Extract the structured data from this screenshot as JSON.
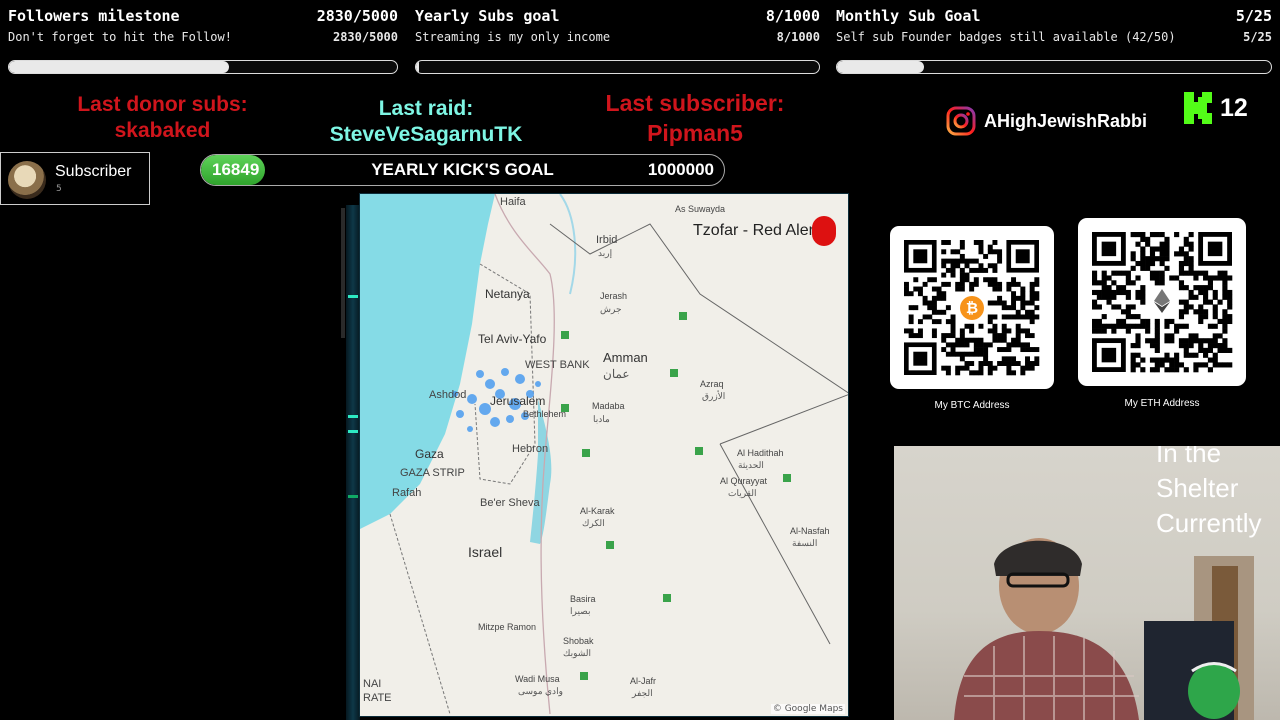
{
  "goals": [
    {
      "title": "Followers milestone",
      "count": "2830/5000",
      "subtitle": "Don't forget to hit the Follow!",
      "count_small": "2830/5000",
      "progress": 0.566
    },
    {
      "title": "Yearly Subs goal",
      "count": "8/1000",
      "subtitle": "Streaming is my only income",
      "count_small": "8/1000",
      "progress": 0.008
    },
    {
      "title": "Monthly Sub Goal",
      "count": "5/25",
      "subtitle": "Self sub Founder badges still available (42/50)",
      "count_small": "5/25",
      "progress": 0.2
    }
  ],
  "events": {
    "donor": {
      "label": "Last donor subs:",
      "value": "skabaked"
    },
    "raid": {
      "label": "Last raid:",
      "value": "SteveVeSagarnuTK"
    },
    "subscriber": {
      "label": "Last subscriber:",
      "value": "Pipman5"
    }
  },
  "social": {
    "instagram_icon": "instagram-icon",
    "handle": "AHighJewishRabbi",
    "kick_icon": "kick-logo-icon",
    "viewer_count": "12"
  },
  "subscriber_card": {
    "label": "Subscriber",
    "count": "5"
  },
  "kick_goal": {
    "current": "16849",
    "label": "YEARLY KICK'S GOAL",
    "target": "1000000",
    "progress": 0.017
  },
  "map": {
    "alert_title": "Tzofar - Red Alert",
    "labels": {
      "haifa": "Haifa",
      "as_suwayda": "As Suwayda",
      "irbid": "Irbid",
      "irbid_ar": "إربد",
      "jerash": "Jerash",
      "jerash_ar": "جرش",
      "netanya": "Netanya",
      "tel_aviv": "Tel Aviv-Yafo",
      "west_bank": "WEST BANK",
      "amman": "Amman",
      "amman_ar": "عمان",
      "ashdod": "Ashdod",
      "jerusalem": "Jerusalem",
      "bethlehem": "Bethlehem",
      "madaba": "Madaba",
      "madaba_ar": "مادبا",
      "azraq": "Azraq",
      "azraq_ar": "الأزرق",
      "gaza": "Gaza",
      "gaza_strip": "GAZA STRIP",
      "hebron": "Hebron",
      "rafah": "Rafah",
      "al_haditha": "Al Hadithah",
      "al_haditha_ar": "الحديثة",
      "al_qurayyat": "Al Qurayyat",
      "al_qurayyat_ar": "القريات",
      "beer_sheva": "Be'er Sheva",
      "al_karak": "Al-Karak",
      "al_karak_ar": "الكرك",
      "israel": "Israel",
      "al_nasfah": "Al-Nasfah",
      "al_nasfah_ar": "النسفة",
      "basira": "Basira",
      "basira_ar": "بصيرا",
      "mitzpe_ramon": "Mitzpe Ramon",
      "shobak": "Shobak",
      "shobak_ar": "الشوبك",
      "wadi_musa": "Wadi Musa",
      "wadi_musa_ar": "وادي موسى",
      "al_jafr": "Al-Jafr",
      "al_jafr_ar": "الجفر",
      "sinai": "NAI",
      "sinai2": "RATE"
    },
    "attribution": "© Google Maps"
  },
  "crypto": {
    "btc_label": "My BTC Address",
    "eth_label": "My ETH Address",
    "btc_icon": "bitcoin-icon",
    "eth_icon": "ethereum-icon"
  },
  "webcam": {
    "overlay_line1": "In the",
    "overlay_line2": "Shelter",
    "overlay_line3": "Currently"
  }
}
